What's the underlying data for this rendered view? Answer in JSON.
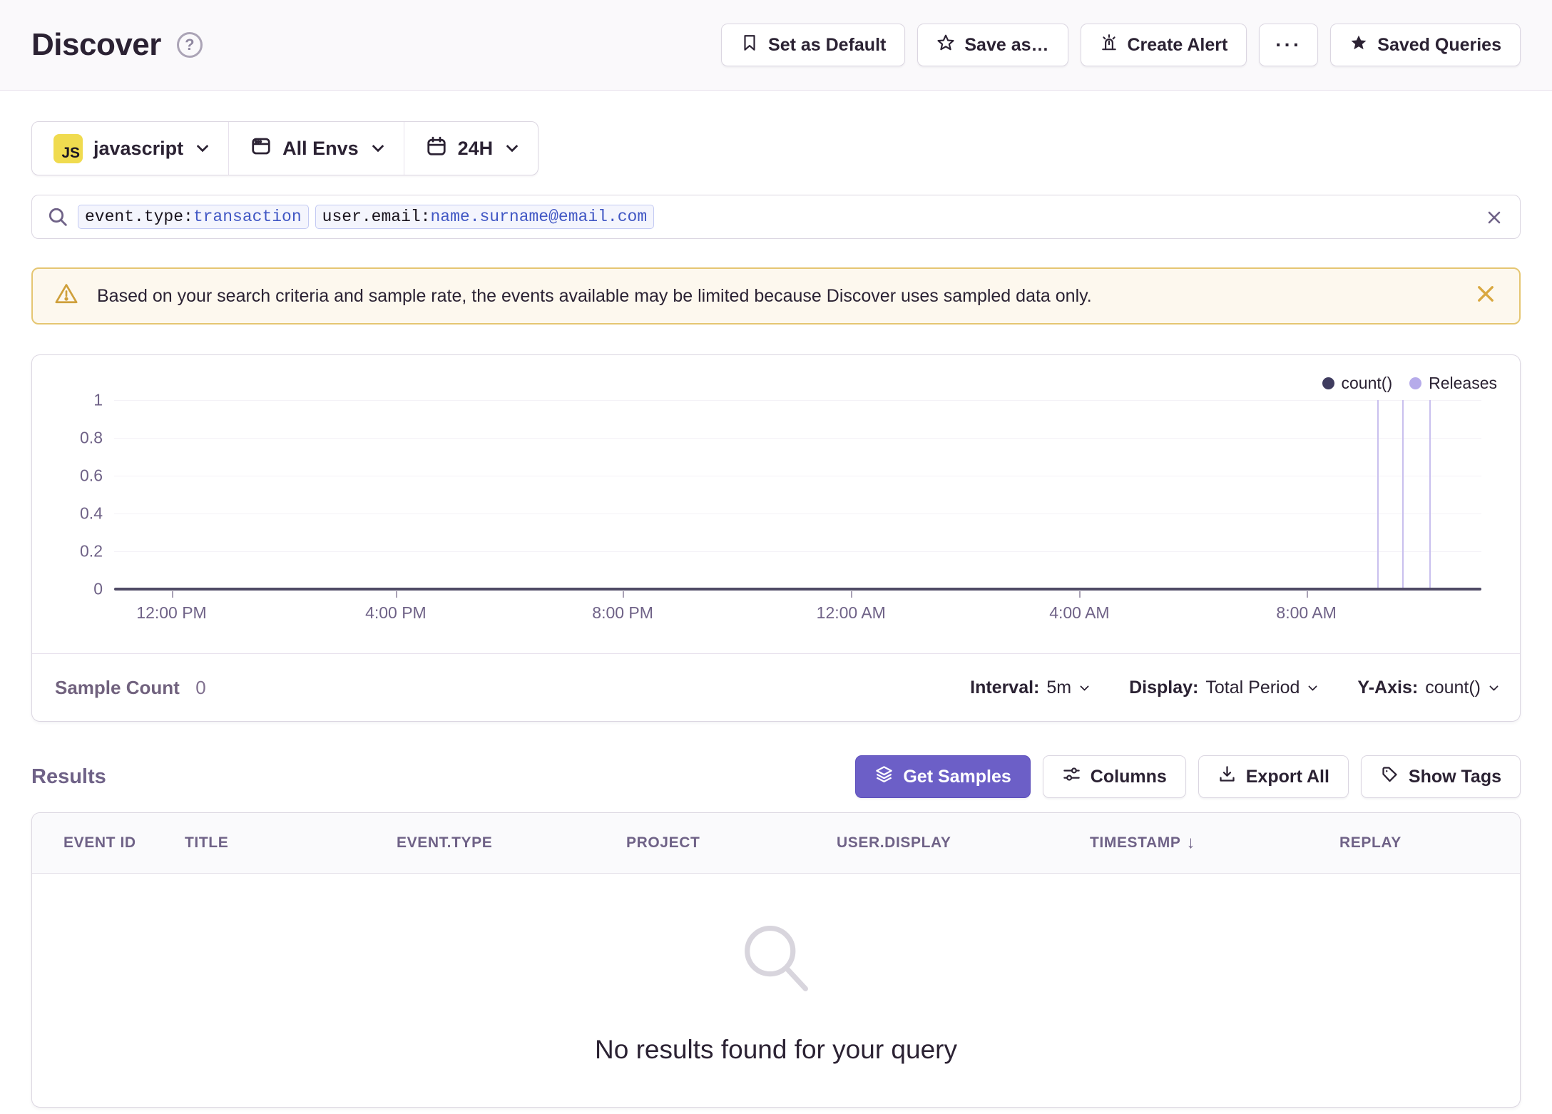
{
  "header": {
    "title": "Discover",
    "actions": [
      {
        "label": "Set as Default"
      },
      {
        "label": "Save as…"
      },
      {
        "label": "Create Alert"
      },
      {
        "label": "···"
      },
      {
        "label": "Saved Queries"
      }
    ]
  },
  "filters": {
    "project_badge": "JS",
    "project": "javascript",
    "environment": "All Envs",
    "period": "24H"
  },
  "search": {
    "tokens": [
      {
        "key": "event.type:",
        "value": "transaction"
      },
      {
        "key": "user.email:",
        "value": "name.surname@email.com"
      }
    ]
  },
  "banner": {
    "message": "Based on your search criteria and sample rate, the events available may be limited because Discover uses sampled data only."
  },
  "chart_data": {
    "type": "line",
    "title": "",
    "ylim": [
      0,
      1
    ],
    "y_ticks": [
      0,
      0.2,
      0.4,
      0.6,
      0.8,
      1
    ],
    "x_tick_labels": [
      "12:00 PM",
      "4:00 PM",
      "8:00 PM",
      "12:00 AM",
      "4:00 AM",
      "8:00 AM"
    ],
    "x_tick_fractions": [
      0.042,
      0.206,
      0.372,
      0.539,
      0.706,
      0.872
    ],
    "grid": true,
    "legend_position": "top-right",
    "series": [
      {
        "name": "count()",
        "color": "#4F4A65",
        "values": [
          0,
          0,
          0,
          0,
          0,
          0,
          0
        ]
      }
    ],
    "releases": {
      "name": "Releases",
      "color": "#C9C0EE",
      "x_fractions": [
        0.924,
        0.942,
        0.962
      ]
    },
    "legend": [
      {
        "label": "count()",
        "color": "#3F3C5F"
      },
      {
        "label": "Releases",
        "color": "#B6ABEA"
      }
    ]
  },
  "chart_footer": {
    "sample_count_label": "Sample Count",
    "sample_count_value": "0",
    "controls": [
      {
        "label": "Interval:",
        "value": "5m"
      },
      {
        "label": "Display:",
        "value": "Total Period"
      },
      {
        "label": "Y-Axis:",
        "value": "count()"
      }
    ]
  },
  "results": {
    "title": "Results",
    "buttons": [
      {
        "label": "Get Samples"
      },
      {
        "label": "Columns"
      },
      {
        "label": "Export All"
      },
      {
        "label": "Show Tags"
      }
    ],
    "table": {
      "columns": [
        "EVENT ID",
        "TITLE",
        "EVENT.TYPE",
        "PROJECT",
        "USER.DISPLAY",
        "TIMESTAMP",
        "REPLAY"
      ],
      "sorted_column": "TIMESTAMP",
      "sort_direction": "desc",
      "empty_message": "No results found for your query"
    }
  },
  "icons": {
    "help": "?",
    "sort_desc": "↓"
  },
  "colors": {
    "accent": "#6C5FC7",
    "dark_text": "#2B2233",
    "muted_text": "#80708F",
    "border": "#DBD6E1",
    "warning_bg": "#FDF8EE",
    "warning_border": "#E5C672",
    "warning_icon": "#CFA03B",
    "js_badge": "#F0DB4F",
    "token_value": "#4157C4",
    "count_series": "#4F4A65",
    "releases": "#C9C0EE"
  }
}
